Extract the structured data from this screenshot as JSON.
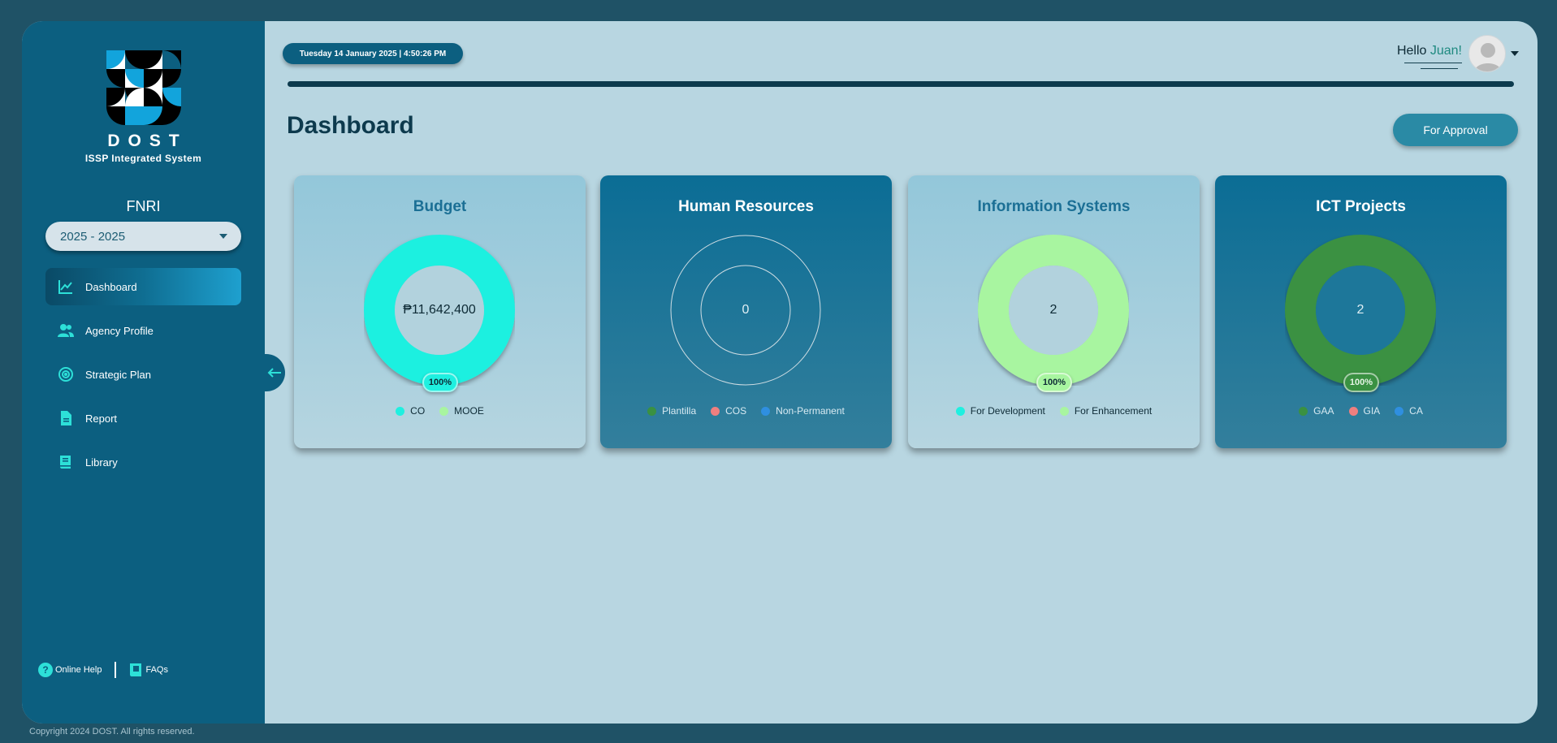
{
  "sidebar": {
    "brand": "DOST",
    "brand_sub": "ISSP Integrated System",
    "agency": "FNRI",
    "year_select": "2025 - 2025",
    "items": [
      {
        "label": "Dashboard",
        "icon": "chart-line-icon",
        "active": true
      },
      {
        "label": "Agency Profile",
        "icon": "users-icon",
        "active": false
      },
      {
        "label": "Strategic Plan",
        "icon": "target-icon",
        "active": false
      },
      {
        "label": "Report",
        "icon": "document-icon",
        "active": false
      },
      {
        "label": "Library",
        "icon": "book-icon",
        "active": false
      }
    ],
    "online_help": "Online Help",
    "faqs": "FAQs"
  },
  "header": {
    "datetime": "Tuesday 14 January 2025 | 4:50:26 PM",
    "hello": "Hello",
    "user_name": "Juan!"
  },
  "main": {
    "title": "Dashboard",
    "approval_button": "For Approval"
  },
  "cards": [
    {
      "title": "Budget",
      "center": "₱11,642,400",
      "percent": "100%",
      "legend": [
        {
          "label": "CO",
          "color": "#1ff0e0"
        },
        {
          "label": "MOOE",
          "color": "#a8f5a0"
        }
      ]
    },
    {
      "title": "Human Resources",
      "center": "0",
      "percent": "",
      "legend": [
        {
          "label": "Plantilla",
          "color": "#3a9142"
        },
        {
          "label": "COS",
          "color": "#ef7f7f"
        },
        {
          "label": "Non-Permanent",
          "color": "#2f8fe0"
        }
      ]
    },
    {
      "title": "Information Systems",
      "center": "2",
      "percent": "100%",
      "legend": [
        {
          "label": "For Development",
          "color": "#1ff0e0"
        },
        {
          "label": "For Enhancement",
          "color": "#a8f5a0"
        }
      ]
    },
    {
      "title": "ICT Projects",
      "center": "2",
      "percent": "100%",
      "legend": [
        {
          "label": "GAA",
          "color": "#3a9142"
        },
        {
          "label": "GIA",
          "color": "#ef7f7f"
        },
        {
          "label": "CA",
          "color": "#2f8fe0"
        }
      ]
    }
  ],
  "footer": "Copyright 2024 DOST. All rights reserved."
}
